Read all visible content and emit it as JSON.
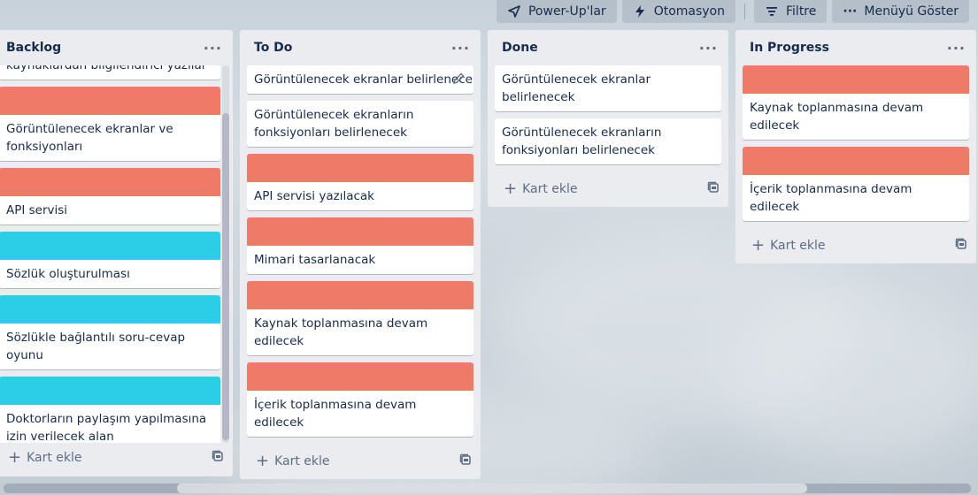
{
  "toolbar": {
    "powerups_label": "Power-Up'lar",
    "automation_label": "Otomasyon",
    "filter_label": "Filtre",
    "menu_label": "Menüyü Göster"
  },
  "colors": {
    "salmon": "#f07a68",
    "cyan": "#2ccde6"
  },
  "lists": {
    "backlog": {
      "title": "Backlog",
      "menu": "···",
      "add_label": "Kart ekle",
      "cards": [
        {
          "text": "kaynaklardan bilgilendirici yazılar"
        },
        {
          "text": "Görüntülenecek ekranlar ve fonksiyonları",
          "cover": "salmon"
        },
        {
          "text": "API servisi",
          "cover": "salmon"
        },
        {
          "text": "Sözlük oluşturulması",
          "cover": "cyan"
        },
        {
          "text": "Sözlükle bağlantılı soru-cevap oyunu",
          "cover": "cyan"
        },
        {
          "text": "Doktorların paylaşım yapılmasına izin verilecek alan",
          "cover": "cyan"
        }
      ]
    },
    "todo": {
      "title": "To Do",
      "menu": "···",
      "add_label": "Kart ekle",
      "cards": [
        {
          "text": "Görüntülenecek ekranlar belirlenecek"
        },
        {
          "text": "Görüntülenecek ekranların fonksiyonları belirlenecek"
        },
        {
          "text": "API servisi yazılacak",
          "cover": "salmon"
        },
        {
          "text": "Mimari tasarlanacak",
          "cover": "salmon"
        },
        {
          "text": "Kaynak toplanmasına devam edilecek",
          "cover": "salmon"
        },
        {
          "text": "İçerik toplanmasına devam edilecek",
          "cover": "salmon"
        }
      ]
    },
    "done": {
      "title": "Done",
      "menu": "···",
      "add_label": "Kart ekle",
      "cards": [
        {
          "text": "Görüntülenecek ekranlar belirlenecek"
        },
        {
          "text": "Görüntülenecek ekranların fonksiyonları belirlenecek"
        }
      ]
    },
    "inprogress": {
      "title": "In Progress",
      "menu": "···",
      "add_label": "Kart ekle",
      "cards": [
        {
          "text": "Kaynak toplanmasına devam edilecek",
          "cover": "salmon"
        },
        {
          "text": "İçerik toplanmasına devam edilecek",
          "cover": "salmon"
        }
      ]
    }
  }
}
